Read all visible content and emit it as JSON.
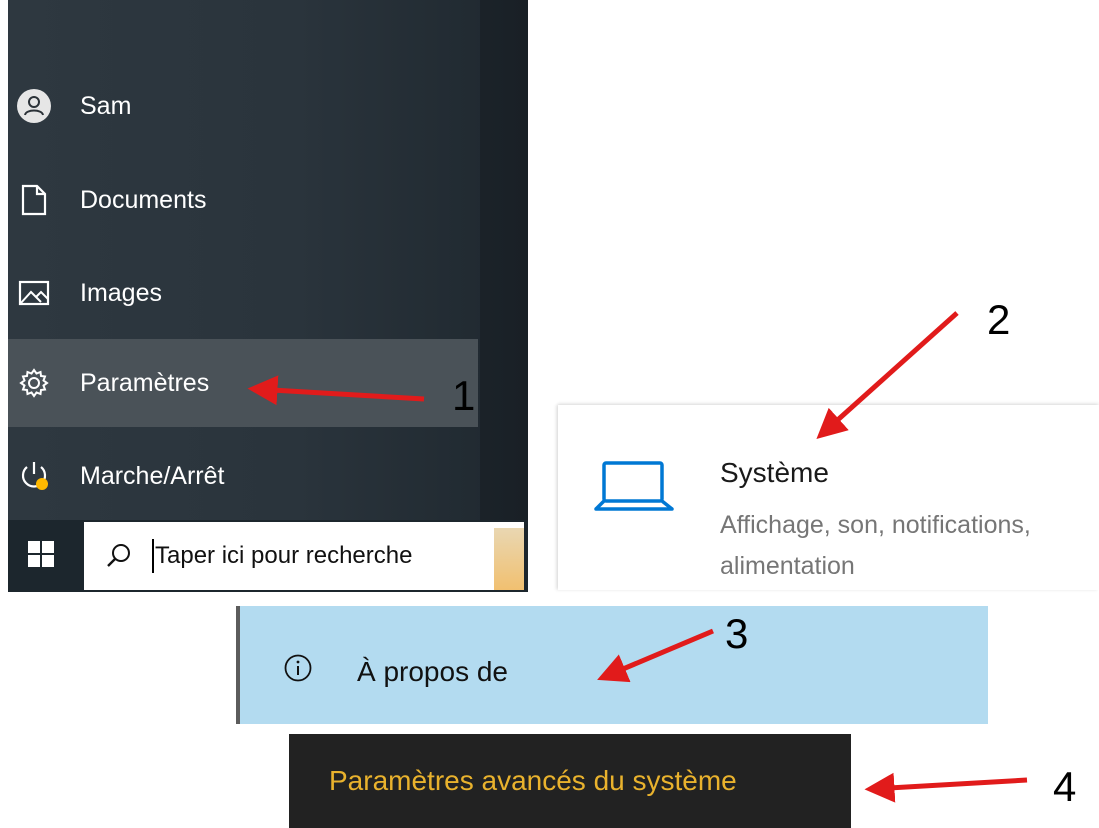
{
  "start_menu": {
    "items": [
      {
        "label": "Sam",
        "icon": "user-avatar-icon"
      },
      {
        "label": "Documents",
        "icon": "document-icon"
      },
      {
        "label": "Images",
        "icon": "image-icon"
      },
      {
        "label": "Paramètres",
        "icon": "gear-icon",
        "selected": true
      },
      {
        "label": "Marche/Arrêt",
        "icon": "power-icon",
        "badge_color": "#ffb900"
      }
    ]
  },
  "taskbar": {
    "start_icon": "windows-logo-icon",
    "search_icon": "search-icon",
    "search_placeholder": "Taper ici pour recherche"
  },
  "settings_tile": {
    "icon": "laptop-icon",
    "title": "Système",
    "description": "Affichage, son, notifications, alimentation",
    "accent_color": "#0078d4"
  },
  "about_nav": {
    "icon": "info-icon",
    "label": "À propos de",
    "background": "#b3dbf0"
  },
  "advanced_link": {
    "label": "Paramètres avancés du système",
    "color": "#e9b22d"
  },
  "annotations": {
    "arrow_color": "#e11b1b",
    "steps": [
      "1",
      "2",
      "3",
      "4"
    ]
  }
}
